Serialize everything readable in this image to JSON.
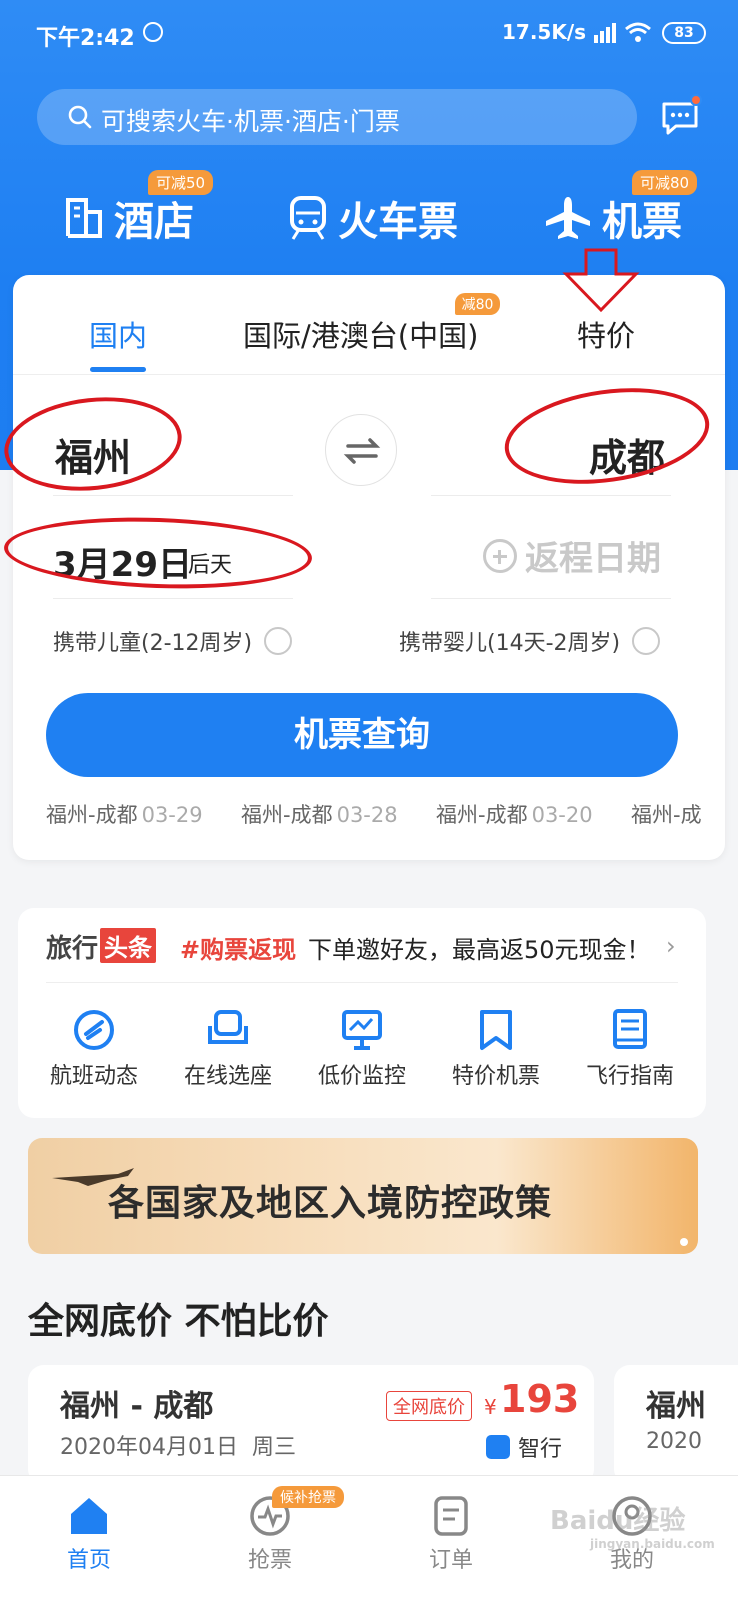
{
  "status_bar": {
    "time": "下午2:42",
    "speed": "17.5K/s",
    "battery": "83"
  },
  "search": {
    "placeholder": "可搜索火车·机票·酒店·门票"
  },
  "categories": [
    {
      "label": "酒店",
      "badge": "可减50",
      "icon": "hotel-icon"
    },
    {
      "label": "火车票",
      "badge": "",
      "icon": "train-icon"
    },
    {
      "label": "机票",
      "badge": "可减80",
      "icon": "plane-icon"
    }
  ],
  "tabs": [
    {
      "label": "国内",
      "active": true
    },
    {
      "label": "国际/港澳台(中国)",
      "badge": "减80"
    },
    {
      "label": "特价"
    }
  ],
  "flight_form": {
    "from_city": "福州",
    "to_city": "成都",
    "depart_date": "3月29日",
    "depart_day": "后天",
    "return_placeholder": "返程日期",
    "child_option": "携带儿童(2-12周岁)",
    "infant_option": "携带婴儿(14天-2周岁)",
    "search_button": "机票查询"
  },
  "history": [
    {
      "route": "福州-成都",
      "date": "03-29"
    },
    {
      "route": "福州-成都",
      "date": "03-28"
    },
    {
      "route": "福州-成都",
      "date": "03-20"
    },
    {
      "route": "福州-成",
      "date": ""
    }
  ],
  "news": {
    "brand_a": "旅行",
    "brand_b": "头条",
    "tag": "#购票返现",
    "text": "下单邀好友，最高返50元现金！"
  },
  "quick_links": [
    {
      "label": "航班动态",
      "icon": "flight-status-icon"
    },
    {
      "label": "在线选座",
      "icon": "seat-icon"
    },
    {
      "label": "低价监控",
      "icon": "monitor-icon"
    },
    {
      "label": "特价机票",
      "icon": "bookmark-icon"
    },
    {
      "label": "飞行指南",
      "icon": "guide-icon"
    }
  ],
  "banner": {
    "title": "各国家及地区入境防控政策"
  },
  "section_title": "全网底价 不怕比价",
  "deals": [
    {
      "route": "福州 - 成都",
      "date": "2020年04月01日",
      "weekday": "周三",
      "label": "全网底价",
      "currency": "¥",
      "price": "193",
      "provider": "智行"
    },
    {
      "route": "福州",
      "date": "2020",
      "weekday": ""
    }
  ],
  "bottom_nav": [
    {
      "label": "首页",
      "active": true,
      "icon": "home-icon"
    },
    {
      "label": "抢票",
      "badge": "候补抢票",
      "icon": "grab-ticket-icon"
    },
    {
      "label": "订单",
      "icon": "order-icon"
    },
    {
      "label": "我的",
      "icon": "profile-icon"
    }
  ],
  "watermark": {
    "main": "Baidu经验",
    "sub": "jingyan.baidu.com"
  },
  "colors": {
    "primary": "#1f80f2",
    "accent": "#f59a3b",
    "price": "#e8453c",
    "annotation": "#d9181f"
  }
}
